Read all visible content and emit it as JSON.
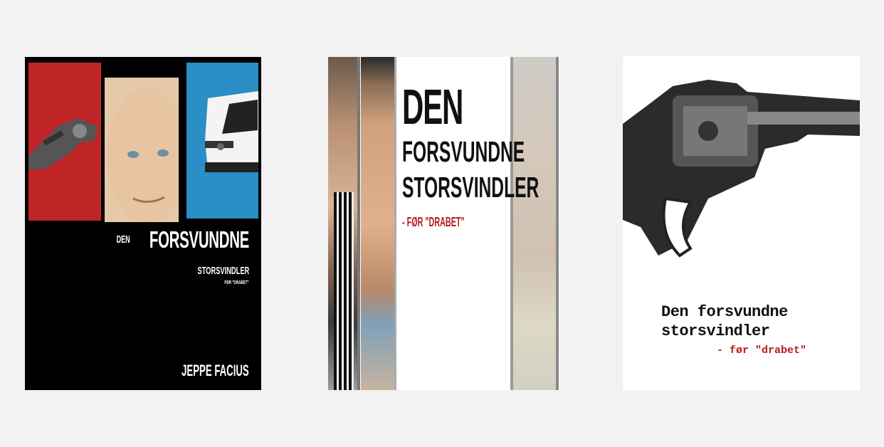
{
  "covers": [
    {
      "title_den": "DEN",
      "title_forsvundne": "FORSVUNDNE",
      "title_storsvindler": "STORSVINDLER",
      "subtitle": "FØR \"DRABET\"",
      "author": "JEPPE FACIUS",
      "colors": {
        "background": "#000000",
        "red_panel": "#bf2426",
        "blue_panel": "#2a8fc4",
        "text": "#ffffff"
      }
    },
    {
      "title_den": "DEN",
      "title_forsvundne": "FORSVUNDNE",
      "title_storsvindler": "STORSVINDLER",
      "subtitle": "- FØR \"DRABET\"",
      "colors": {
        "background": "#ffffff",
        "text": "#111111",
        "subtitle": "#b51c1c"
      }
    },
    {
      "title_line1": "Den forsvundne",
      "title_line2": "storsvindler",
      "subtitle": "- før \"drabet\"",
      "colors": {
        "background": "#ffffff",
        "text": "#111111",
        "subtitle": "#b51c1c"
      }
    }
  ]
}
